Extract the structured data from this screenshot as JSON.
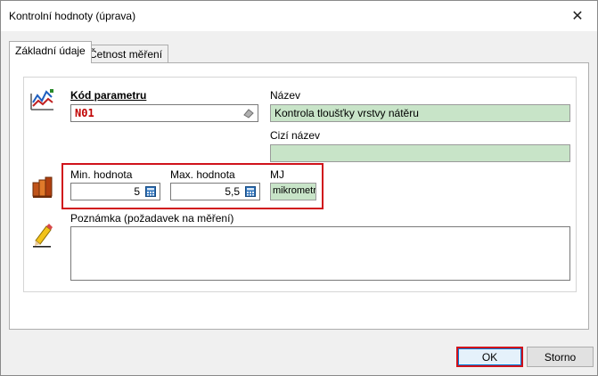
{
  "window": {
    "title": "Kontrolní hodnoty (úprava)"
  },
  "tabs": [
    {
      "label": "Základní údaje",
      "active": true
    },
    {
      "label": "Četnost měření",
      "active": false
    }
  ],
  "form": {
    "kod_label": "Kód parametru",
    "kod_value": "N01",
    "nazev_label": "Název",
    "nazev_value": "Kontrola tloušťky vrstvy nátěru",
    "cizi_nazev_label": "Cizí název",
    "cizi_nazev_value": "",
    "min_label": "Min. hodnota",
    "min_value": "5",
    "max_label": "Max. hodnota",
    "max_value": "5,5",
    "mj_label": "MJ",
    "mj_value": "mikrometr",
    "poznamka_label": "Poznámka (požadavek na měření)",
    "poznamka_value": ""
  },
  "buttons": {
    "ok": "OK",
    "cancel": "Storno"
  },
  "colors": {
    "highlight": "#d0121b",
    "readonly_field": "#c8e4c8",
    "code_text": "#c00000"
  },
  "icons": [
    "chart-icon",
    "books-icon",
    "pencil-note-icon",
    "eraser-icon",
    "calculator-icon",
    "close-icon"
  ]
}
